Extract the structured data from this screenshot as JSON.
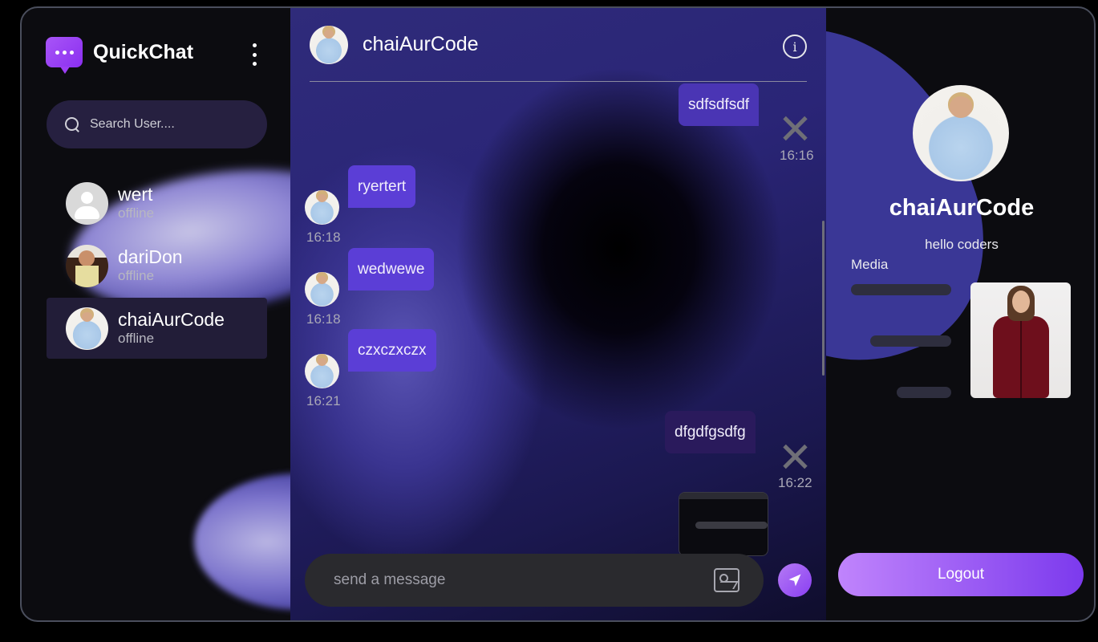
{
  "app": {
    "name": "QuickChat",
    "accent": "#8b2ff0"
  },
  "sidebar": {
    "search_placeholder": "Search User....",
    "users": [
      {
        "name": "wert",
        "status": "offline",
        "avatar": "default-avatar-icon"
      },
      {
        "name": "dariDon",
        "status": "offline",
        "avatar": "photo"
      },
      {
        "name": "chaiAurCode",
        "status": "offline",
        "avatar": "photo",
        "active": true
      }
    ]
  },
  "chat": {
    "title": "chaiAurCode",
    "messages": [
      {
        "text": "sdfsdfsdf",
        "direction": "sent",
        "time": "16:16"
      },
      {
        "text": "ryertert",
        "direction": "received",
        "time": "16:18"
      },
      {
        "text": "wedwewe",
        "direction": "received",
        "time": "16:18"
      },
      {
        "text": "czxczxczx",
        "direction": "received",
        "time": "16:21"
      },
      {
        "text": "dfgdfgsdfg",
        "direction": "sent",
        "time": "16:22"
      }
    ],
    "composer_placeholder": "send a message"
  },
  "profile": {
    "name": "chaiAurCode",
    "bio": "hello coders",
    "media_label": "Media",
    "logout_label": "Logout"
  }
}
